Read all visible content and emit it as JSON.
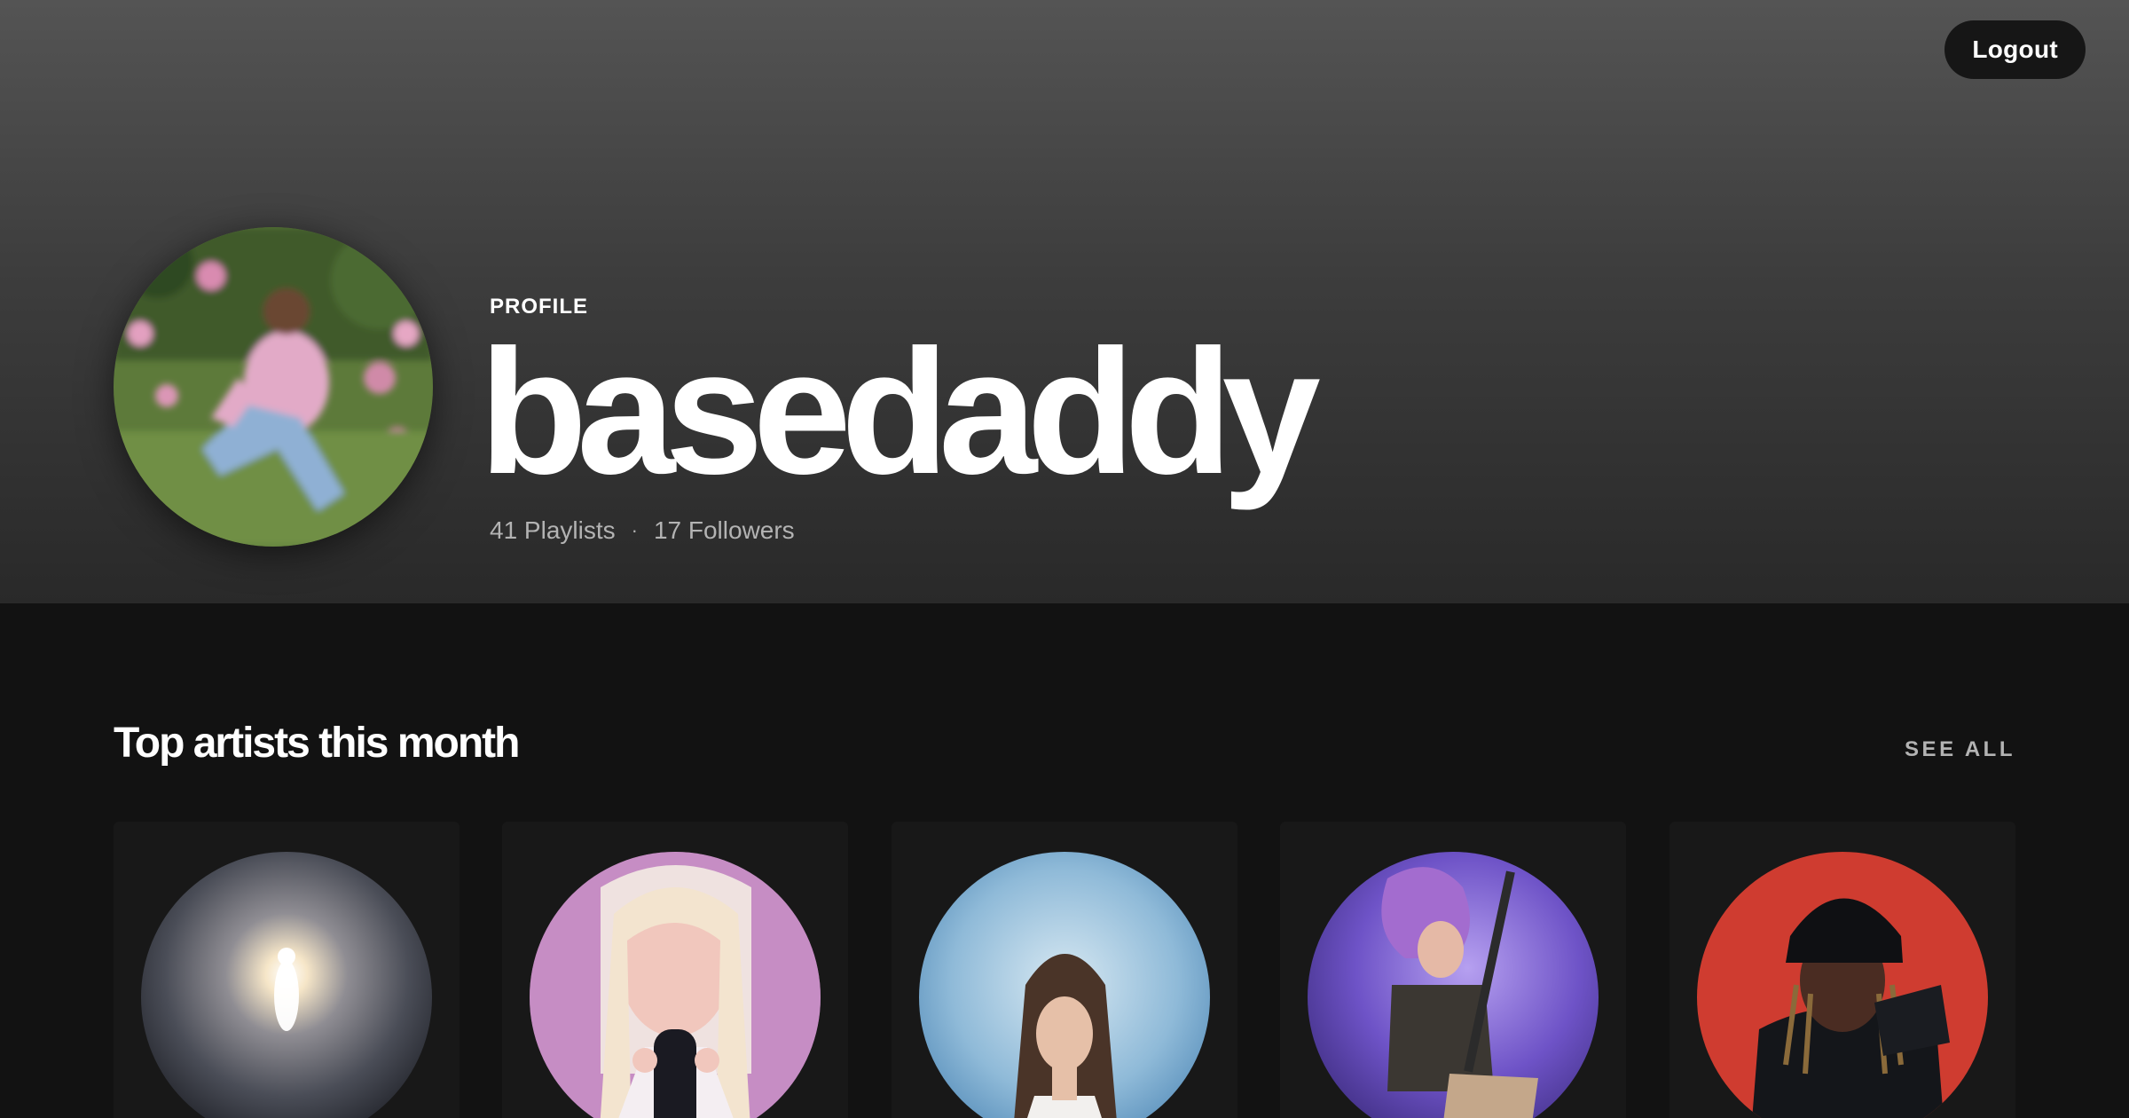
{
  "header": {
    "logout_label": "Logout"
  },
  "profile": {
    "label": "PROFILE",
    "username": "basedaddy",
    "playlists": "41 Playlists",
    "separator": "·",
    "followers": "17 Followers"
  },
  "top_artists": {
    "title": "Top artists this month",
    "see_all_label": "SEE ALL",
    "artists": [
      {
        "image": "glowing-figure-art"
      },
      {
        "image": "woman-with-microphone-art"
      },
      {
        "image": "woman-blue-background-art"
      },
      {
        "image": "guitarist-purple-stage-art"
      },
      {
        "image": "man-black-beanie-red-background-art"
      }
    ]
  },
  "colors": {
    "background": "#121212",
    "card": "#181818",
    "secondary_text": "#b3b3b3",
    "button": "#161616"
  }
}
